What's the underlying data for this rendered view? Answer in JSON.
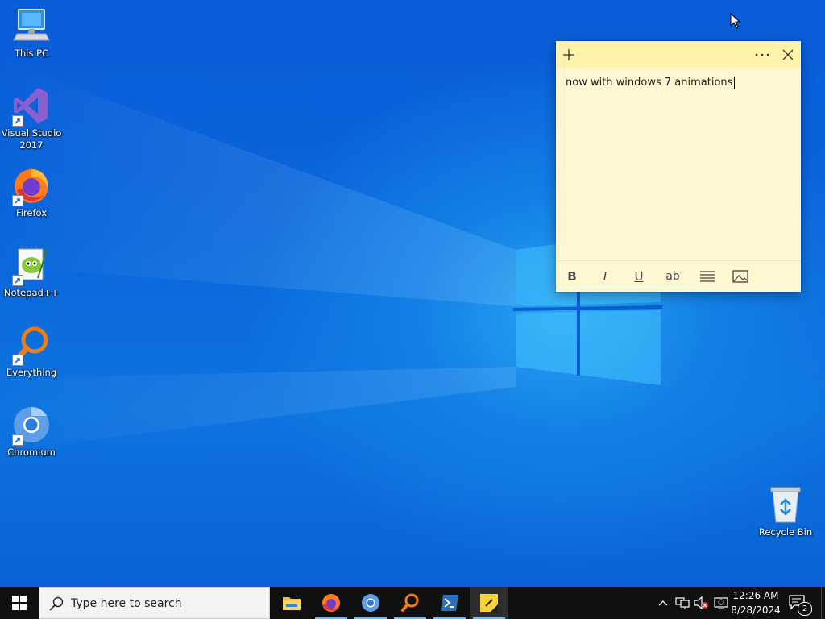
{
  "desktop": {
    "icons": [
      {
        "label": "This PC",
        "icon": "this-pc-icon"
      },
      {
        "label": "Visual Studio\n2017",
        "icon": "visual-studio-icon"
      },
      {
        "label": "Firefox",
        "icon": "firefox-icon"
      },
      {
        "label": "Notepad++",
        "icon": "notepad-plus-plus-icon"
      },
      {
        "label": "Everything",
        "icon": "everything-icon"
      },
      {
        "label": "Chromium",
        "icon": "chromium-icon"
      },
      {
        "label": "Recycle Bin",
        "icon": "recycle-bin-icon"
      }
    ]
  },
  "sticky_note": {
    "text": "now with windows 7 animations",
    "header_buttons": [
      "plus-icon",
      "more-icon",
      "close-icon"
    ],
    "toolbar": {
      "bold": "B",
      "italic": "I",
      "underline": "U",
      "strikethrough": "ab",
      "icons": [
        "bold-icon",
        "italic-icon",
        "underline-icon",
        "strikethrough-icon",
        "list-icon",
        "image-icon"
      ]
    },
    "colors": {
      "body": "#fff7d1",
      "header": "#fff2ab"
    }
  },
  "taskbar": {
    "search_placeholder": "Type here to search",
    "pinned_apps": [
      "file-explorer-icon",
      "firefox-icon",
      "chromium-icon",
      "everything-icon",
      "powershell-icon",
      "sticky-notes-icon"
    ],
    "active_app": "sticky-notes-icon",
    "tray_icons": [
      "chevron-up-icon",
      "network-icon",
      "volume-muted-icon",
      "display-icon"
    ],
    "clock": {
      "time": "12:26 AM",
      "date": "8/28/2024"
    },
    "notification_count": "2"
  }
}
